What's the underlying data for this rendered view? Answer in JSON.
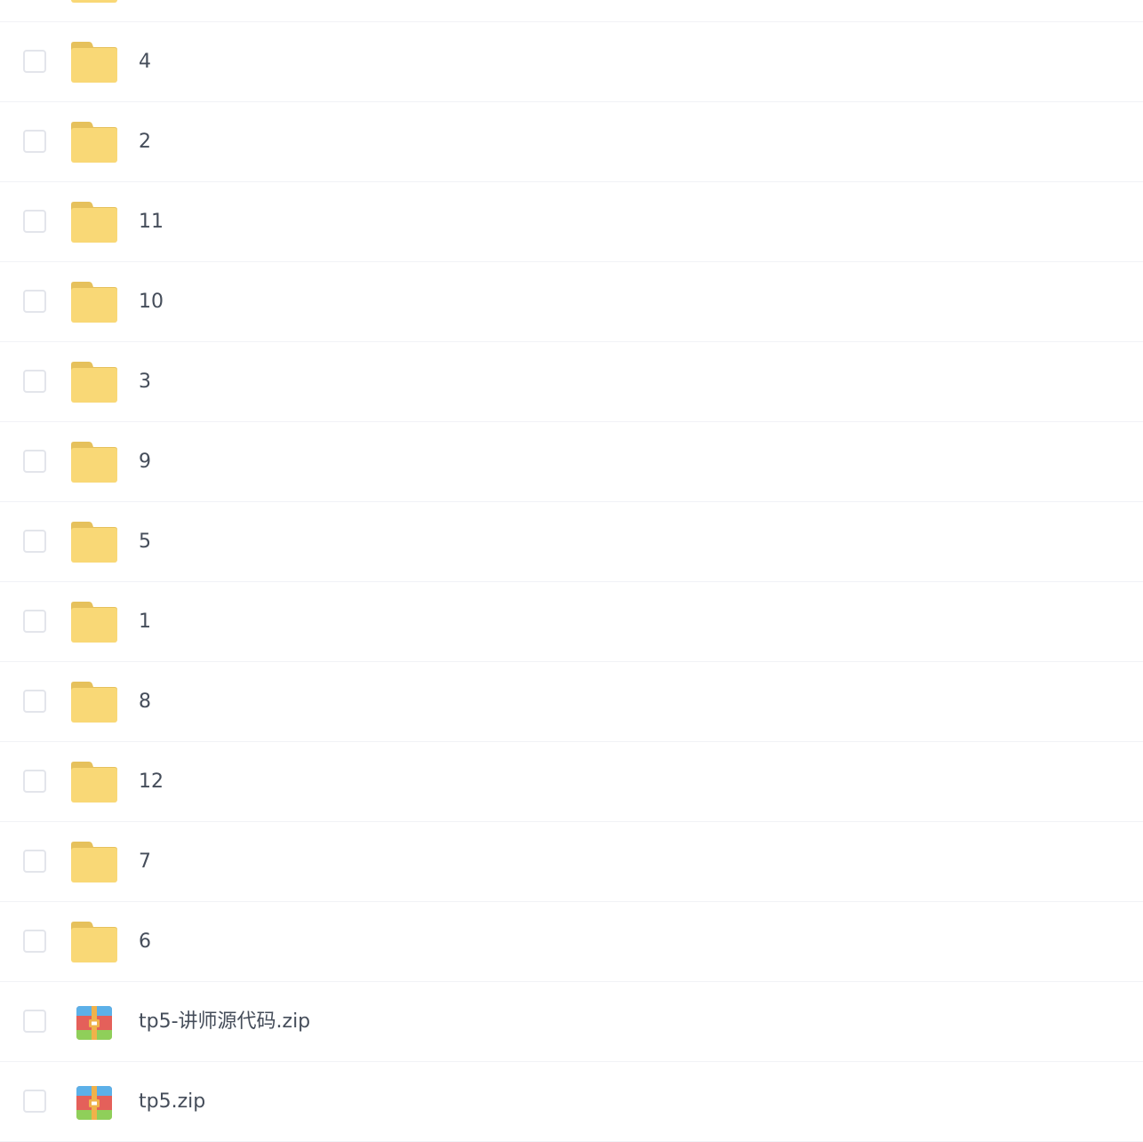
{
  "colors": {
    "folder_body": "#f9d876",
    "folder_tab": "#e6c15c",
    "row_divider": "#f1f2f6",
    "text": "#454d5a",
    "checkbox_border": "#e3e5eb"
  },
  "files": [
    {
      "name": "",
      "type": "folder",
      "icon": "folder-icon"
    },
    {
      "name": "4",
      "type": "folder",
      "icon": "folder-icon"
    },
    {
      "name": "2",
      "type": "folder",
      "icon": "folder-icon"
    },
    {
      "name": "11",
      "type": "folder",
      "icon": "folder-icon"
    },
    {
      "name": "10",
      "type": "folder",
      "icon": "folder-icon"
    },
    {
      "name": "3",
      "type": "folder",
      "icon": "folder-icon"
    },
    {
      "name": "9",
      "type": "folder",
      "icon": "folder-icon"
    },
    {
      "name": "5",
      "type": "folder",
      "icon": "folder-icon"
    },
    {
      "name": "1",
      "type": "folder",
      "icon": "folder-icon"
    },
    {
      "name": "8",
      "type": "folder",
      "icon": "folder-icon"
    },
    {
      "name": "12",
      "type": "folder",
      "icon": "folder-icon"
    },
    {
      "name": "7",
      "type": "folder",
      "icon": "folder-icon"
    },
    {
      "name": "6",
      "type": "folder",
      "icon": "folder-icon"
    },
    {
      "name": "tp5-讲师源代码.zip",
      "type": "zip",
      "icon": "zip-archive-icon"
    },
    {
      "name": "tp5.zip",
      "type": "zip",
      "icon": "zip-archive-icon"
    }
  ]
}
